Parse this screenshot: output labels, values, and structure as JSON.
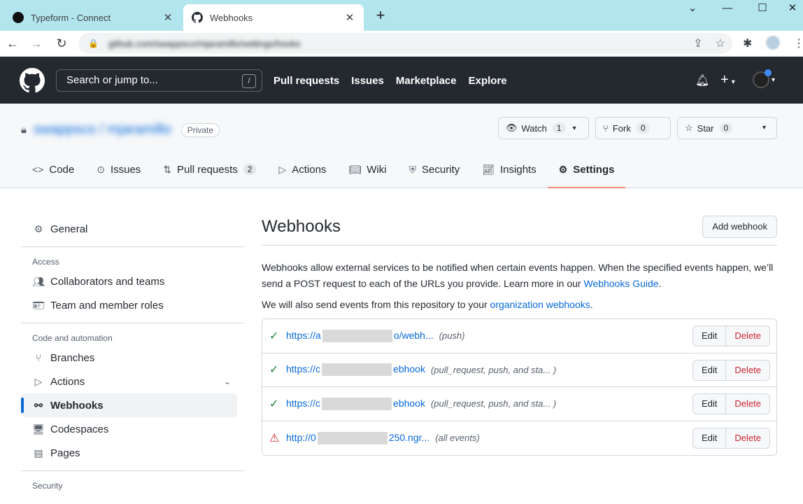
{
  "browser": {
    "tabs": [
      {
        "title": "Typeform - Connect",
        "close": "✕"
      },
      {
        "title": "Webhooks",
        "close": "✕"
      }
    ],
    "new_tab": "+",
    "window": {
      "minimize": "—",
      "maximize": "☐",
      "close": "✕",
      "tablist": "⌄"
    },
    "address": "github.com/swappsco/mjaramillo/settings/hooks"
  },
  "github": {
    "search_placeholder": "Search or jump to...",
    "search_key": "/",
    "nav": [
      "Pull requests",
      "Issues",
      "Marketplace",
      "Explore"
    ]
  },
  "repo": {
    "owner_name": "swappsco / mjaramillo",
    "visibility": "Private",
    "watch": {
      "label": "Watch",
      "count": "1"
    },
    "fork": {
      "label": "Fork",
      "count": "0"
    },
    "star": {
      "label": "Star",
      "count": "0"
    },
    "tabs": [
      {
        "label": "Code",
        "icon": "code-icon"
      },
      {
        "label": "Issues",
        "icon": "issue-icon"
      },
      {
        "label": "Pull requests",
        "icon": "pull-request-icon",
        "count": "2"
      },
      {
        "label": "Actions",
        "icon": "play-icon"
      },
      {
        "label": "Wiki",
        "icon": "book-icon"
      },
      {
        "label": "Security",
        "icon": "shield-icon"
      },
      {
        "label": "Insights",
        "icon": "graph-icon"
      },
      {
        "label": "Settings",
        "icon": "gear-icon",
        "selected": true
      }
    ]
  },
  "sidebar": {
    "general": "General",
    "access_title": "Access",
    "access": [
      "Collaborators and teams",
      "Team and member roles"
    ],
    "automation_title": "Code and automation",
    "automation": [
      "Branches",
      "Actions",
      "Webhooks",
      "Codespaces",
      "Pages"
    ],
    "security_title": "Security"
  },
  "main": {
    "title": "Webhooks",
    "add_button": "Add webhook",
    "desc_text": "Webhooks allow external services to be notified when certain events happen. When the specified events happen, we’ll send a POST request to each of the URLs you provide. Learn more in our ",
    "desc_link": "Webhooks Guide",
    "desc_end": ".",
    "desc2_text": "We will also send events from this repository to your ",
    "desc2_link": "organization webhooks",
    "desc2_end": ".",
    "hooks": [
      {
        "status": "ok",
        "url_start": "https://a",
        "url_end": "o/webh...",
        "events": "(push)"
      },
      {
        "status": "ok",
        "url_start": "https://c",
        "url_end": "ebhook",
        "events": "(pull_request, push, and sta... )"
      },
      {
        "status": "ok",
        "url_start": "https://c",
        "url_end": "ebhook",
        "events": "(pull_request, push, and sta... )"
      },
      {
        "status": "error",
        "url_start": "http://0",
        "url_end": "250.ngr...",
        "events": "(all events)"
      }
    ],
    "edit_label": "Edit",
    "delete_label": "Delete"
  }
}
